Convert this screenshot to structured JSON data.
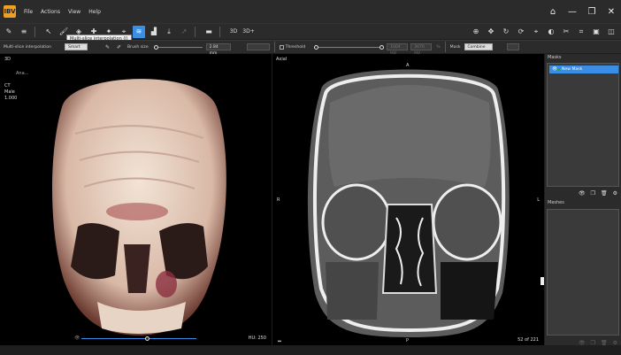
{
  "app": {
    "logo_text": "IBV"
  },
  "menu": [
    "File",
    "Actions",
    "View",
    "Help"
  ],
  "tooltip": "Multi-slice interpolation (I)",
  "options": {
    "interp_label": "Multi-slice interpolation",
    "interp_value": "Smart",
    "brush_label": "Brush size",
    "brush_value": "2.84 mm",
    "threshold_label": "Threshold",
    "threshold_min": "1004 HU",
    "threshold_max": "3070 HU",
    "mask_label": "Mask",
    "mask_mode": "Combine"
  },
  "view3d": {
    "title": "3D",
    "patient_name": "Ana...",
    "info_lines": [
      "CT",
      "Male",
      "1.000"
    ],
    "hu_label": "HU: 250"
  },
  "axial": {
    "title": "Axial",
    "orient_top": "A",
    "orient_bottom": "P",
    "orient_left": "R",
    "orient_right": "L",
    "slice_label": "52 of 221"
  },
  "masks": {
    "title": "Masks",
    "items": [
      {
        "label": "New Mask"
      }
    ]
  },
  "meshes": {
    "title": "Meshes"
  }
}
